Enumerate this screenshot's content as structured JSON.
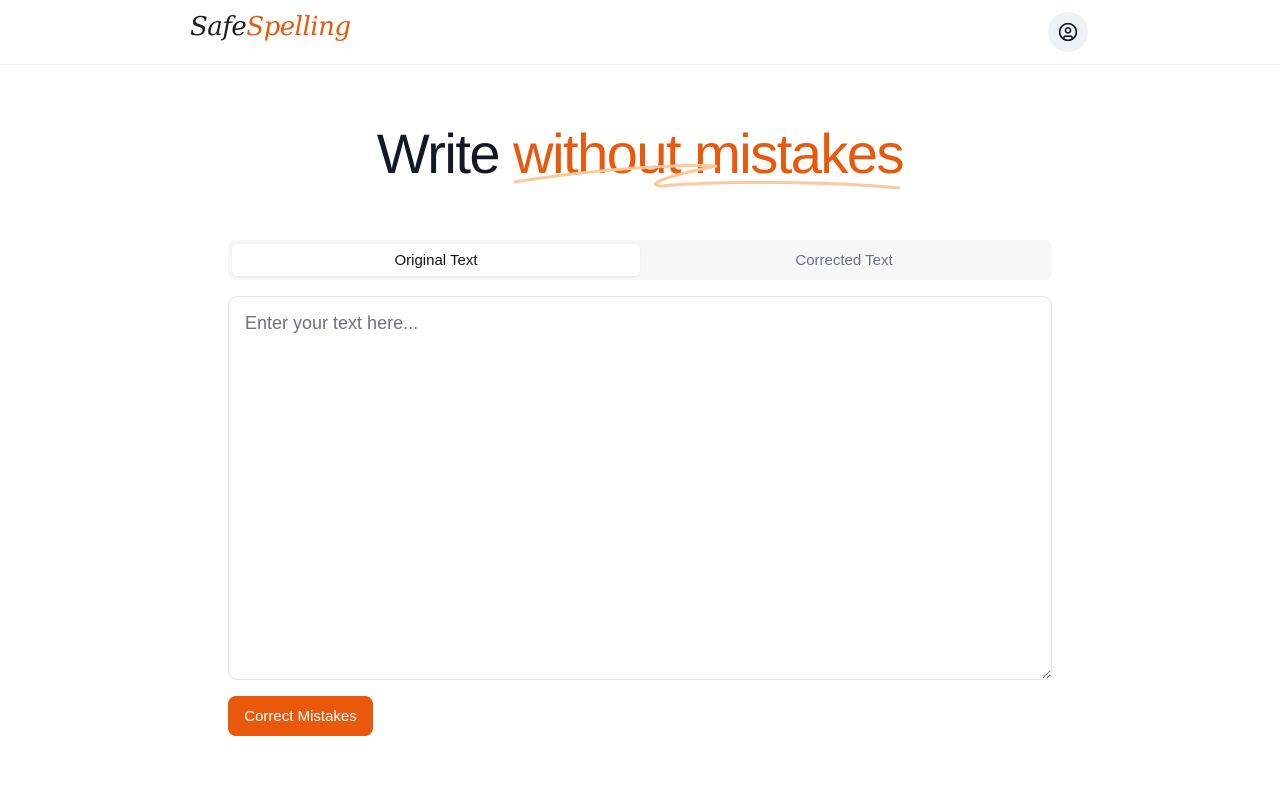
{
  "header": {
    "logo_part1": "Safe",
    "logo_part2": "Spelling",
    "account_icon": "user-circle-icon"
  },
  "hero": {
    "title_part1": "Write",
    "title_part2": "without mistakes"
  },
  "tabs": [
    {
      "label": "Original Text",
      "active": true
    },
    {
      "label": "Corrected Text",
      "active": false
    }
  ],
  "editor": {
    "value": "",
    "placeholder": "Enter your text here..."
  },
  "actions": {
    "correct_label": "Correct Mistakes"
  },
  "colors": {
    "accent": "#ea580c",
    "accent_light": "#fdba74",
    "text_dark": "#111827",
    "muted": "#64748b"
  }
}
